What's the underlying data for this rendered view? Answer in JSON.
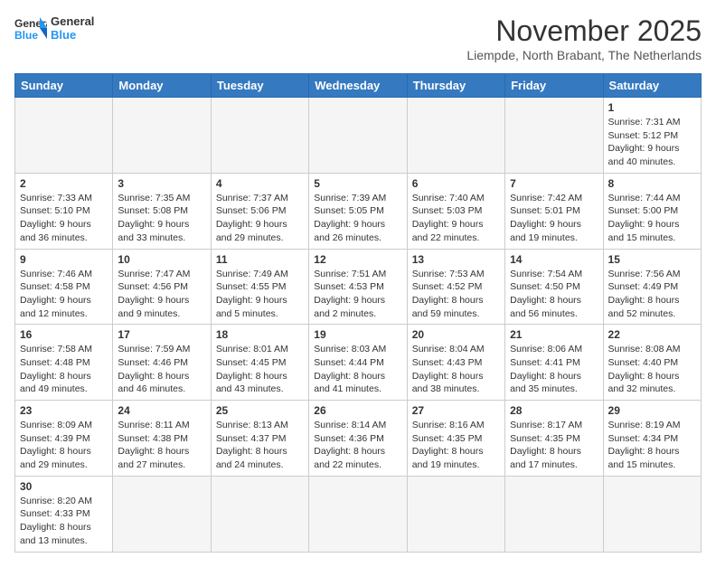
{
  "header": {
    "logo_general": "General",
    "logo_blue": "Blue",
    "month_title": "November 2025",
    "subtitle": "Liempde, North Brabant, The Netherlands"
  },
  "weekdays": [
    "Sunday",
    "Monday",
    "Tuesday",
    "Wednesday",
    "Thursday",
    "Friday",
    "Saturday"
  ],
  "weeks": [
    [
      {
        "day": "",
        "info": ""
      },
      {
        "day": "",
        "info": ""
      },
      {
        "day": "",
        "info": ""
      },
      {
        "day": "",
        "info": ""
      },
      {
        "day": "",
        "info": ""
      },
      {
        "day": "",
        "info": ""
      },
      {
        "day": "1",
        "info": "Sunrise: 7:31 AM\nSunset: 5:12 PM\nDaylight: 9 hours and 40 minutes."
      }
    ],
    [
      {
        "day": "2",
        "info": "Sunrise: 7:33 AM\nSunset: 5:10 PM\nDaylight: 9 hours and 36 minutes."
      },
      {
        "day": "3",
        "info": "Sunrise: 7:35 AM\nSunset: 5:08 PM\nDaylight: 9 hours and 33 minutes."
      },
      {
        "day": "4",
        "info": "Sunrise: 7:37 AM\nSunset: 5:06 PM\nDaylight: 9 hours and 29 minutes."
      },
      {
        "day": "5",
        "info": "Sunrise: 7:39 AM\nSunset: 5:05 PM\nDaylight: 9 hours and 26 minutes."
      },
      {
        "day": "6",
        "info": "Sunrise: 7:40 AM\nSunset: 5:03 PM\nDaylight: 9 hours and 22 minutes."
      },
      {
        "day": "7",
        "info": "Sunrise: 7:42 AM\nSunset: 5:01 PM\nDaylight: 9 hours and 19 minutes."
      },
      {
        "day": "8",
        "info": "Sunrise: 7:44 AM\nSunset: 5:00 PM\nDaylight: 9 hours and 15 minutes."
      }
    ],
    [
      {
        "day": "9",
        "info": "Sunrise: 7:46 AM\nSunset: 4:58 PM\nDaylight: 9 hours and 12 minutes."
      },
      {
        "day": "10",
        "info": "Sunrise: 7:47 AM\nSunset: 4:56 PM\nDaylight: 9 hours and 9 minutes."
      },
      {
        "day": "11",
        "info": "Sunrise: 7:49 AM\nSunset: 4:55 PM\nDaylight: 9 hours and 5 minutes."
      },
      {
        "day": "12",
        "info": "Sunrise: 7:51 AM\nSunset: 4:53 PM\nDaylight: 9 hours and 2 minutes."
      },
      {
        "day": "13",
        "info": "Sunrise: 7:53 AM\nSunset: 4:52 PM\nDaylight: 8 hours and 59 minutes."
      },
      {
        "day": "14",
        "info": "Sunrise: 7:54 AM\nSunset: 4:50 PM\nDaylight: 8 hours and 56 minutes."
      },
      {
        "day": "15",
        "info": "Sunrise: 7:56 AM\nSunset: 4:49 PM\nDaylight: 8 hours and 52 minutes."
      }
    ],
    [
      {
        "day": "16",
        "info": "Sunrise: 7:58 AM\nSunset: 4:48 PM\nDaylight: 8 hours and 49 minutes."
      },
      {
        "day": "17",
        "info": "Sunrise: 7:59 AM\nSunset: 4:46 PM\nDaylight: 8 hours and 46 minutes."
      },
      {
        "day": "18",
        "info": "Sunrise: 8:01 AM\nSunset: 4:45 PM\nDaylight: 8 hours and 43 minutes."
      },
      {
        "day": "19",
        "info": "Sunrise: 8:03 AM\nSunset: 4:44 PM\nDaylight: 8 hours and 41 minutes."
      },
      {
        "day": "20",
        "info": "Sunrise: 8:04 AM\nSunset: 4:43 PM\nDaylight: 8 hours and 38 minutes."
      },
      {
        "day": "21",
        "info": "Sunrise: 8:06 AM\nSunset: 4:41 PM\nDaylight: 8 hours and 35 minutes."
      },
      {
        "day": "22",
        "info": "Sunrise: 8:08 AM\nSunset: 4:40 PM\nDaylight: 8 hours and 32 minutes."
      }
    ],
    [
      {
        "day": "23",
        "info": "Sunrise: 8:09 AM\nSunset: 4:39 PM\nDaylight: 8 hours and 29 minutes."
      },
      {
        "day": "24",
        "info": "Sunrise: 8:11 AM\nSunset: 4:38 PM\nDaylight: 8 hours and 27 minutes."
      },
      {
        "day": "25",
        "info": "Sunrise: 8:13 AM\nSunset: 4:37 PM\nDaylight: 8 hours and 24 minutes."
      },
      {
        "day": "26",
        "info": "Sunrise: 8:14 AM\nSunset: 4:36 PM\nDaylight: 8 hours and 22 minutes."
      },
      {
        "day": "27",
        "info": "Sunrise: 8:16 AM\nSunset: 4:35 PM\nDaylight: 8 hours and 19 minutes."
      },
      {
        "day": "28",
        "info": "Sunrise: 8:17 AM\nSunset: 4:35 PM\nDaylight: 8 hours and 17 minutes."
      },
      {
        "day": "29",
        "info": "Sunrise: 8:19 AM\nSunset: 4:34 PM\nDaylight: 8 hours and 15 minutes."
      }
    ],
    [
      {
        "day": "30",
        "info": "Sunrise: 8:20 AM\nSunset: 4:33 PM\nDaylight: 8 hours and 13 minutes."
      },
      {
        "day": "",
        "info": ""
      },
      {
        "day": "",
        "info": ""
      },
      {
        "day": "",
        "info": ""
      },
      {
        "day": "",
        "info": ""
      },
      {
        "day": "",
        "info": ""
      },
      {
        "day": "",
        "info": ""
      }
    ]
  ]
}
